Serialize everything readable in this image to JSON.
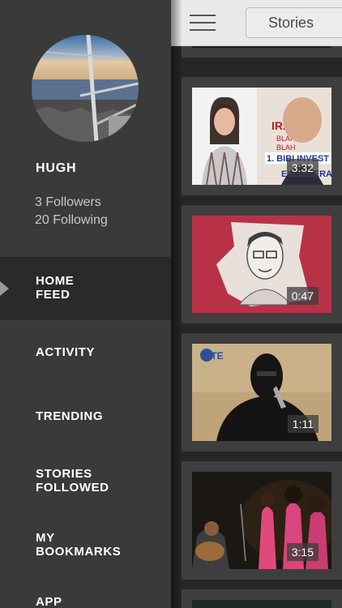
{
  "user": {
    "name": "HUGH",
    "followers": "3 Followers",
    "following": "20 Following"
  },
  "nav": {
    "home_feed": "HOME\nFEED",
    "activity": "ACTIVITY",
    "trending": "TRENDING",
    "stories_followed": "STORIES\nFOLLOWED",
    "my_bookmarks": "MY\nBOOKMARKS",
    "app": "APP"
  },
  "header": {
    "stories_label": "Stories"
  },
  "feed": {
    "videos": [
      {
        "duration": "3:32",
        "overlay_text": "IRAN BLAH BLAH 1. BIBI INVEST EXAGGERAT"
      },
      {
        "duration": "0:47"
      },
      {
        "duration": "1:11",
        "logo_text": "SITE"
      },
      {
        "duration": "3:15"
      }
    ]
  },
  "colors": {
    "sidebar": "#3a3a3a",
    "active_item": "#2a2a2a",
    "header": "#e9e9e9",
    "feed_bg": "#262626"
  }
}
